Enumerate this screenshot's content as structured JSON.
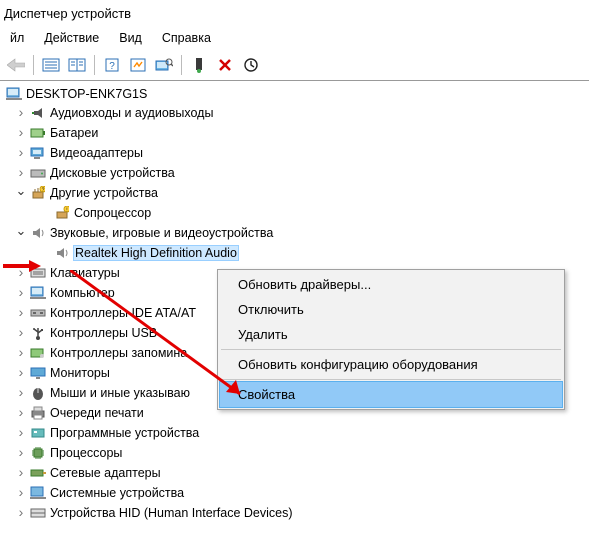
{
  "window": {
    "title": "Диспетчер устройств"
  },
  "menu": {
    "file": "йл",
    "action": "Действие",
    "view": "Вид",
    "help": "Справка"
  },
  "root": {
    "computer_name": "DESKTOP-ENK7G1S"
  },
  "categories": {
    "audio_io": "Аудиовходы и аудиовыходы",
    "batteries": "Батареи",
    "video_adapters": "Видеоадаптеры",
    "disk_drives": "Дисковые устройства",
    "other_devices": "Другие устройства",
    "coprocessor": "Сопроцессор",
    "sound_video_game": "Звуковые, игровые и видеоустройства",
    "realtek": "Realtek High Definition Audio",
    "keyboards": "Клавиатуры",
    "computer": "Компьютер",
    "ide_controllers": "Контроллеры IDE ATA/AT",
    "usb_controllers": "Контроллеры USB",
    "storage_controllers": "Контроллеры запомина",
    "monitors": "Мониторы",
    "mice": "Мыши и иные указываю",
    "print_queues": "Очереди печати",
    "software_devices": "Программные устройства",
    "processors": "Процессоры",
    "network_adapters": "Сетевые адаптеры",
    "system_devices": "Системные устройства",
    "hid": "Устройства HID (Human Interface Devices)"
  },
  "context_menu": {
    "update_drivers": "Обновить драйверы...",
    "disable": "Отключить",
    "delete": "Удалить",
    "scan_hardware": "Обновить конфигурацию оборудования",
    "properties": "Свойства"
  }
}
